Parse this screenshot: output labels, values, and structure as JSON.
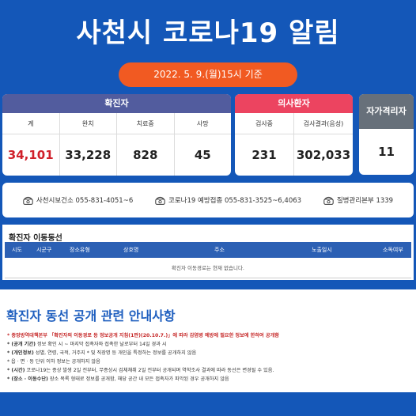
{
  "header": {
    "title": "사천시 코로나19 알림",
    "date": "2022. 5. 9.(월)15시 기준"
  },
  "confirmed": {
    "title": "확진자",
    "columns": [
      "계",
      "완치",
      "치료중",
      "사망"
    ],
    "values": [
      "34,101",
      "33,228",
      "828",
      "45"
    ]
  },
  "hospitalized": {
    "title": "의사환자",
    "columns": [
      "검사중",
      "검사결과(음성)"
    ],
    "values": [
      "231",
      "302,033"
    ]
  },
  "self_quarantine": {
    "title": "자가격리자",
    "value": "11"
  },
  "contacts": [
    "사천시보건소 055-831-4051~6",
    "코로나19 예방접종 055-831-3525~6,4063",
    "질병관리본부 1339"
  ],
  "movement": {
    "title": "확진자 이동동선",
    "columns": [
      "시도",
      "시군구",
      "장소유형",
      "상호명",
      "주소",
      "노출일시",
      "소독여부"
    ],
    "empty_message": "확진자 이동경로는 현재 없습니다."
  },
  "notice": {
    "title": "확진자 동선 공개 관련 안내사항",
    "lines": [
      {
        "prefix": "* 중앙방역대책본부 「확진자의 이동경로 등 정보공개 지침(1판)(20.10.7.)」에 따라 감염병 예방에 필요한 정보에 한하여 공개함",
        "body": ""
      },
      {
        "prefix": "* (공개 기간)",
        "body": " 정보 확인 시 ~ 마지막 접촉자와 접촉한 날로부터 14일 경과 시"
      },
      {
        "prefix": "* (개인정보)",
        "body": " 성별, 연령, 국적, 거주지 * 및 직장명 등 개인을 특정하는 정보를 공개하지 않음"
      },
      {
        "prefix": "",
        "body": "   * 읍 · 면 · 동 단위 이하 정보는 공개하지 않음"
      },
      {
        "prefix": "* (시간)",
        "body": " 코로나19는 증상 발생 2일 전부터, 무증상시 검체채취 2일 전부터 공개되며 역학조사 결과에 따라 동선은 변경될 수 있음."
      },
      {
        "prefix": "* (장소 · 이동수단)",
        "body": " 장소 목록 형태로 정보를 공개함, 해당 공간 내 모든 접촉자가 파악된 경우 공개하지 않음"
      }
    ]
  }
}
